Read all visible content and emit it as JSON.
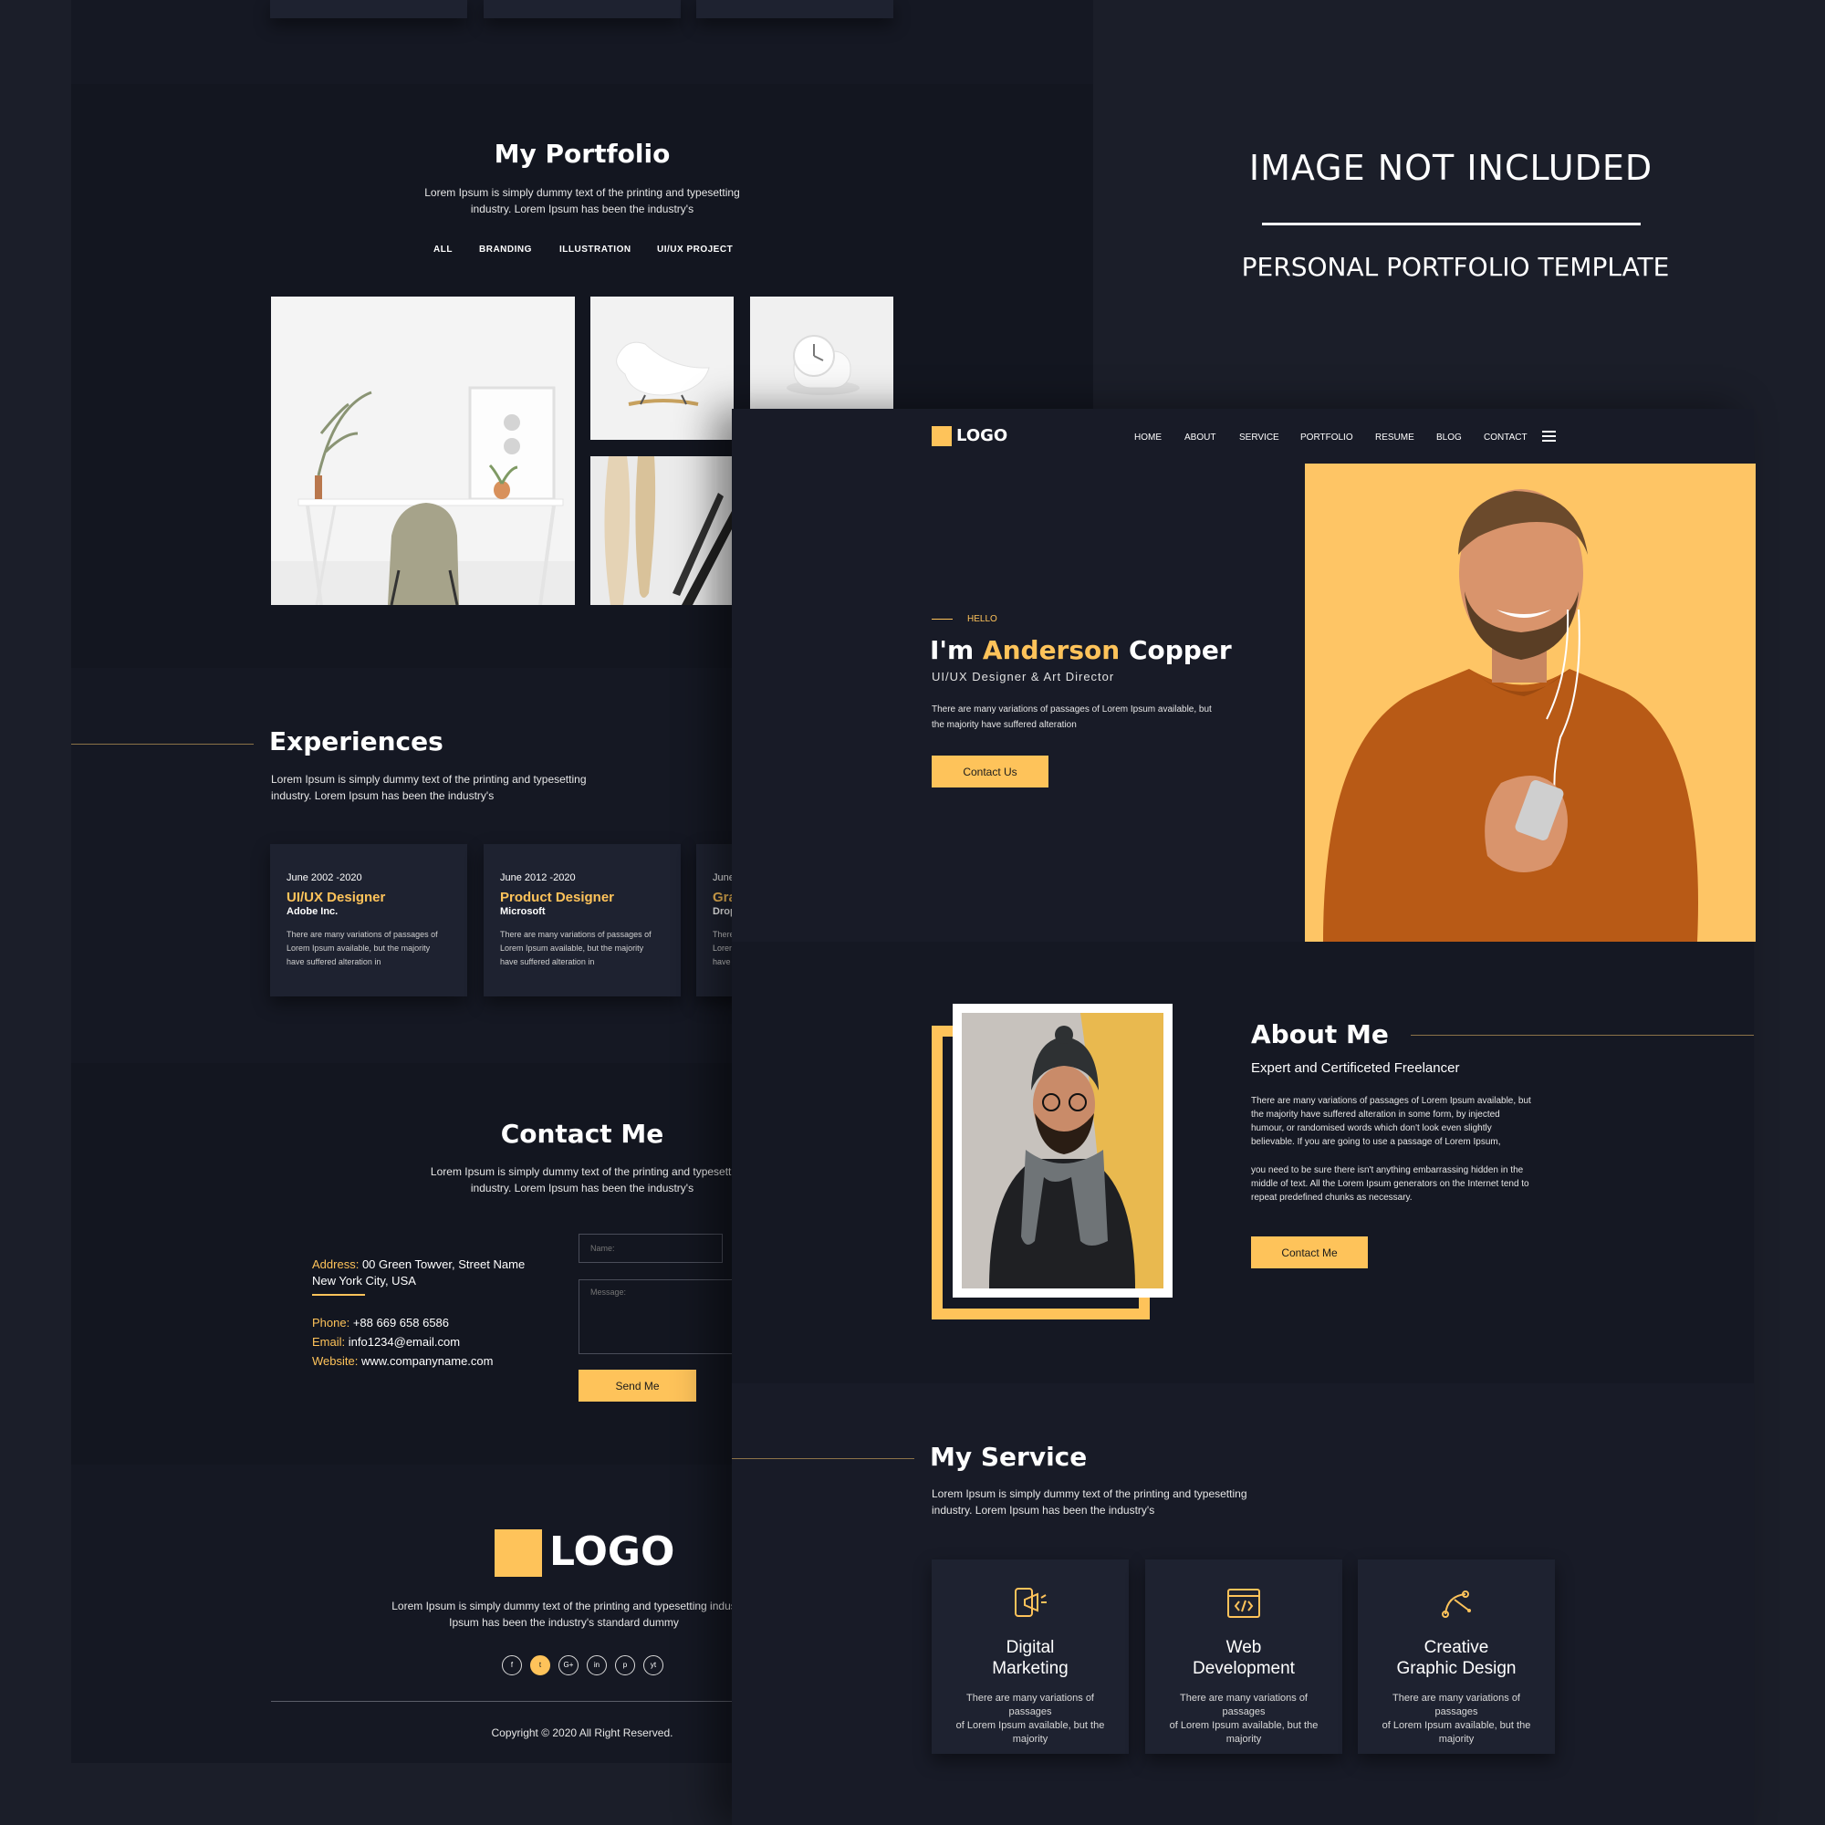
{
  "banner": {
    "heading": "IMAGE NOT INCLUDED",
    "subheading": "PERSONAL PORTFOLIO TEMPLATE"
  },
  "portfolio": {
    "title": "My Portfolio",
    "description_line1": "Lorem Ipsum is simply dummy text of the printing and typesetting",
    "description_line2": "industry. Lorem Ipsum has been the industry's",
    "tabs": [
      "ALL",
      "BRANDING",
      "ILLUSTRATION",
      "UI/UX PROJECT"
    ]
  },
  "experiences": {
    "title": "Experiences",
    "description_line1": "Lorem Ipsum is simply dummy text of the printing and typesetting",
    "description_line2": "industry. Lorem Ipsum has been the industry's",
    "items": [
      {
        "date": "June 2002 -2020",
        "role": "UI/UX Designer",
        "company": "Adobe Inc.",
        "desc1": "There are many variations of passages of",
        "desc2": "Lorem Ipsum available, but the majority",
        "desc3": "have suffered alteration in"
      },
      {
        "date": "June 2012 -2020",
        "role": "Product Designer",
        "company": "Microsoft",
        "desc1": "There are many variations of passages of",
        "desc2": "Lorem Ipsum available, but the majority",
        "desc3": "have suffered alteration in"
      },
      {
        "date": "June",
        "role": "Gra",
        "company": "Drop",
        "desc1": "There",
        "desc2": "Lorem",
        "desc3": "have"
      }
    ]
  },
  "contact": {
    "title": "Contact Me",
    "description_line1": "Lorem Ipsum is simply dummy text of the printing and typesetti",
    "description_line2": "industry. Lorem Ipsum has been the industry's",
    "address_label": "Address:",
    "address_line1": "00 Green Towver, Street Name",
    "address_line2": "New York City, USA",
    "phone_label": "Phone:",
    "phone": "+88 669 658 6586",
    "email_label": "Email:",
    "email": "info1234@email.com",
    "website_label": "Website:",
    "website": "www.companyname.com",
    "name_placeholder": "Name:",
    "message_placeholder": "Message:",
    "send_label": "Send Me"
  },
  "footer": {
    "logo": "LOGO",
    "text_line1": "Lorem Ipsum is simply dummy text of the printing and typesetting indus",
    "text_line2": "Ipsum has been the industry's standard dummy",
    "social": [
      "f",
      "t",
      "G+",
      "in",
      "p",
      "yt"
    ],
    "copyright": "Copyright © 2020  All Right Reserved."
  },
  "nav": {
    "logo": "LOGO",
    "items": [
      "HOME",
      "ABOUT",
      "SERVICE",
      "PORTFOLIO",
      "RESUME",
      "BLOG",
      "CONTACT"
    ]
  },
  "hero": {
    "eyebrow": "HELLO",
    "greeting": "I'm",
    "first_name": "Anderson",
    "last_name": "Copper",
    "subtitle": "UI/UX Designer & Art Director",
    "text_line1": "There are many variations of passages of Lorem Ipsum available, but",
    "text_line2": "the majority have suffered alteration",
    "button": "Contact Us"
  },
  "about": {
    "title": "About Me",
    "subtitle": "Expert and Certificeted Freelancer",
    "p1_l1": "There are many variations of passages of Lorem Ipsum available, but",
    "p1_l2": "the majority have suffered alteration in some form, by injected",
    "p1_l3": "humour, or randomised words which don't look even slightly",
    "p1_l4": "believable. If you are going to use a passage of Lorem Ipsum,",
    "p2_l1": "you need to be sure there isn't anything embarrassing hidden in the",
    "p2_l2": "middle of text. All the Lorem Ipsum generators on the Internet tend to",
    "p2_l3": "repeat predefined chunks as necessary.",
    "button": "Contact Me"
  },
  "service": {
    "title": "My Service",
    "description_line1": "Lorem Ipsum is simply dummy text of the printing and typesetting",
    "description_line2": "industry. Lorem Ipsum has been the industry's",
    "items": [
      {
        "title1": "Digital",
        "title2": "Marketing",
        "d1": "There are many variations of passages",
        "d2": "of Lorem Ipsum available, but the",
        "d3": "majority"
      },
      {
        "title1": "Web",
        "title2": "Development",
        "d1": "There are many variations of passages",
        "d2": "of Lorem Ipsum available, but the",
        "d3": "majority"
      },
      {
        "title1": "Creative",
        "title2": "Graphic Design",
        "d1": "There are many variations of passages",
        "d2": "of Lorem Ipsum available, but the",
        "d3": "majority"
      }
    ]
  },
  "colors": {
    "accent": "#fec35a",
    "background": "#181b27",
    "card": "#1e2230"
  }
}
